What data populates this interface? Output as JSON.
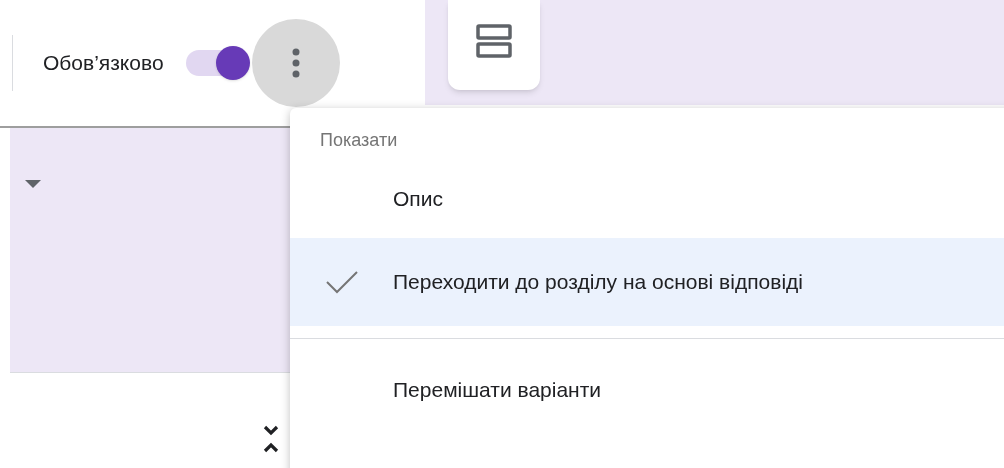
{
  "required_toggle": {
    "label": "Обов’язково",
    "on": true
  },
  "menu": {
    "sections": [
      {
        "header": "Показати",
        "items": [
          {
            "label": "Опис",
            "checked": false
          },
          {
            "label": "Переходити до розділу на основі відповіді",
            "checked": true
          }
        ]
      },
      {
        "items": [
          {
            "label": "Перемішати варіанти",
            "checked": false
          }
        ]
      }
    ]
  }
}
